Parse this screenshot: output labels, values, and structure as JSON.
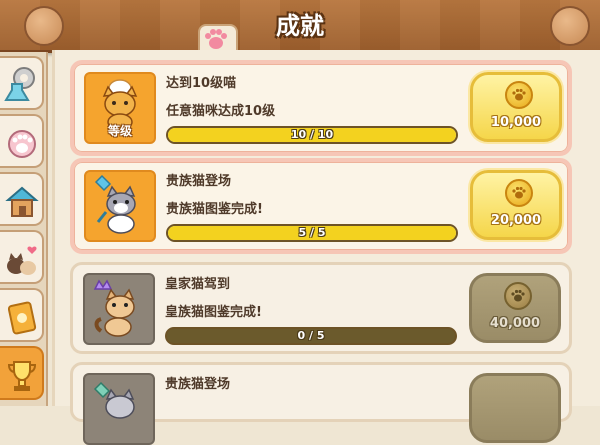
{
  "header": {
    "title": "成就"
  },
  "sidebar": {
    "tabs": [
      {
        "icon": "flask-gear-icon"
      },
      {
        "icon": "paw-icon"
      },
      {
        "icon": "house-icon"
      },
      {
        "icon": "cats-heart-icon"
      },
      {
        "icon": "ticket-icon"
      },
      {
        "icon": "trophy-icon",
        "active": true
      }
    ]
  },
  "achievements": [
    {
      "title": "达到10级喵",
      "description": "任意猫咪达成10级",
      "icon_label": "等级",
      "progress_text": "10 / 10",
      "progress": 1.0,
      "reward": "10,000",
      "status": "completed"
    },
    {
      "title": "贵族猫登场",
      "description": "贵族猫图鉴完成!",
      "progress_text": "5 / 5",
      "progress": 1.0,
      "reward": "20,000",
      "status": "completed"
    },
    {
      "title": "皇家猫驾到",
      "description": "皇族猫图鉴完成!",
      "progress_text": "0 / 5",
      "progress": 0.0,
      "reward": "40,000",
      "status": "locked"
    },
    {
      "title": "贵族猫登场",
      "status": "locked"
    }
  ],
  "colors": {
    "accent_orange": "#f5a42e",
    "progress_yellow": "#f3d21f",
    "header_wood": "#b8773f"
  }
}
